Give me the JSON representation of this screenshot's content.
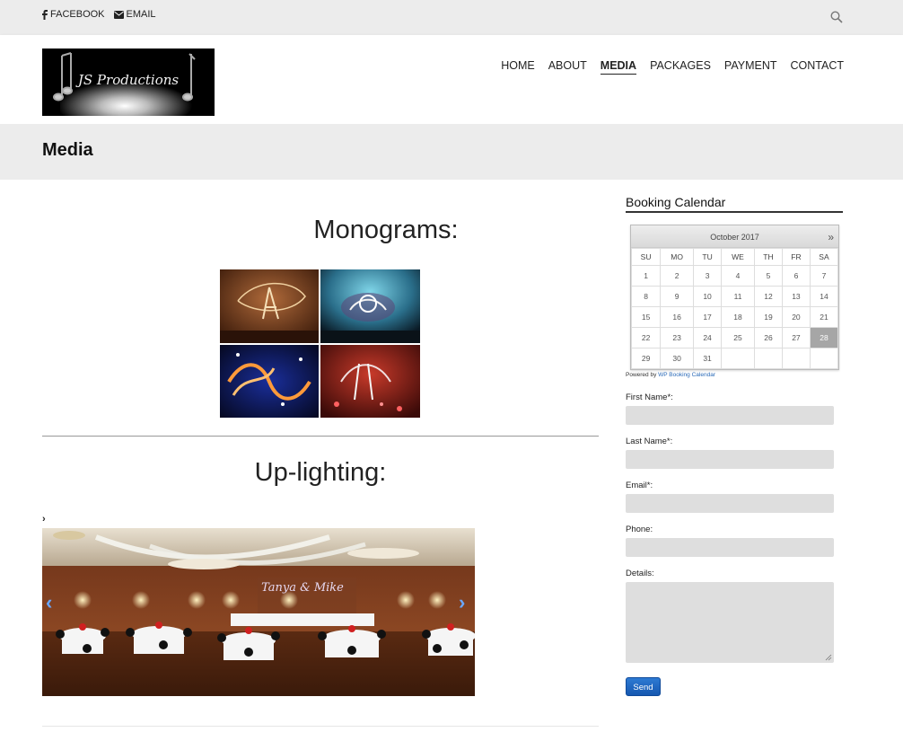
{
  "topbar": {
    "facebook_label": "FACEBOOK",
    "email_label": "EMAIL",
    "search_icon": "search-icon"
  },
  "header": {
    "logo_text": "JS Productions",
    "nav": [
      {
        "label": "HOME"
      },
      {
        "label": "ABOUT"
      },
      {
        "label": "MEDIA"
      },
      {
        "label": "PACKAGES"
      },
      {
        "label": "PAYMENT"
      },
      {
        "label": "CONTACT"
      }
    ],
    "active_nav": "MEDIA"
  },
  "page": {
    "title": "Media"
  },
  "main": {
    "monograms_title": "Monograms:",
    "uplighting_title": "Up-lighting:",
    "small_chevron": "›",
    "slider_text": "Tanya & Mike",
    "slider_prev": "‹",
    "slider_next": "›"
  },
  "sidebar": {
    "widget_title": "Booking Calendar",
    "calendar": {
      "month": "October 2017",
      "next": "»",
      "weekdays": [
        "SU",
        "MO",
        "TU",
        "WE",
        "TH",
        "FR",
        "SA"
      ],
      "weeks": [
        [
          "1",
          "2",
          "3",
          "4",
          "5",
          "6",
          "7"
        ],
        [
          "8",
          "9",
          "10",
          "11",
          "12",
          "13",
          "14"
        ],
        [
          "15",
          "16",
          "17",
          "18",
          "19",
          "20",
          "21"
        ],
        [
          "22",
          "23",
          "24",
          "25",
          "26",
          "27",
          "28"
        ],
        [
          "29",
          "30",
          "31",
          "",
          "",
          "",
          ""
        ]
      ],
      "selected_day": "28"
    },
    "powered_prefix": "Powered by",
    "powered_link": "WP Booking Calendar",
    "form": {
      "first_name_label": "First Name*:",
      "last_name_label": "Last Name*:",
      "email_label": "Email*:",
      "phone_label": "Phone:",
      "details_label": "Details:",
      "send_label": "Send"
    }
  },
  "colors": {
    "topbar_bg": "#ececec",
    "titlebar_bg": "#ececec",
    "field_bg": "#dedede",
    "send_btn": "#1a64c0",
    "link": "#2a6ab8"
  }
}
